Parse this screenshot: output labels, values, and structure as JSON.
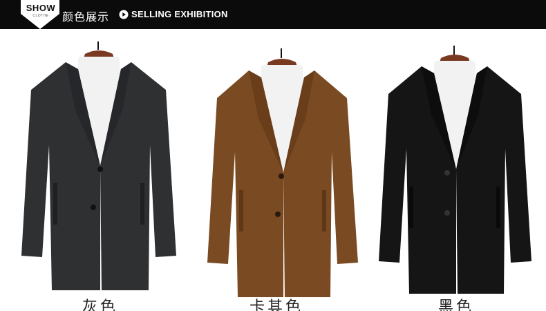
{
  "header": {
    "badge_title": "SHOW",
    "badge_subtitle": "CLOTHE",
    "title_cn": "颜色展示",
    "title_en": "SELLING EXHIBITION",
    "icon": "play-circle-icon"
  },
  "products": [
    {
      "color_label": "灰色",
      "coat_color": "#2e3032"
    },
    {
      "color_label": "卡其色",
      "coat_color": "#7a4a22"
    },
    {
      "color_label": "黑色",
      "coat_color": "#151515"
    }
  ]
}
